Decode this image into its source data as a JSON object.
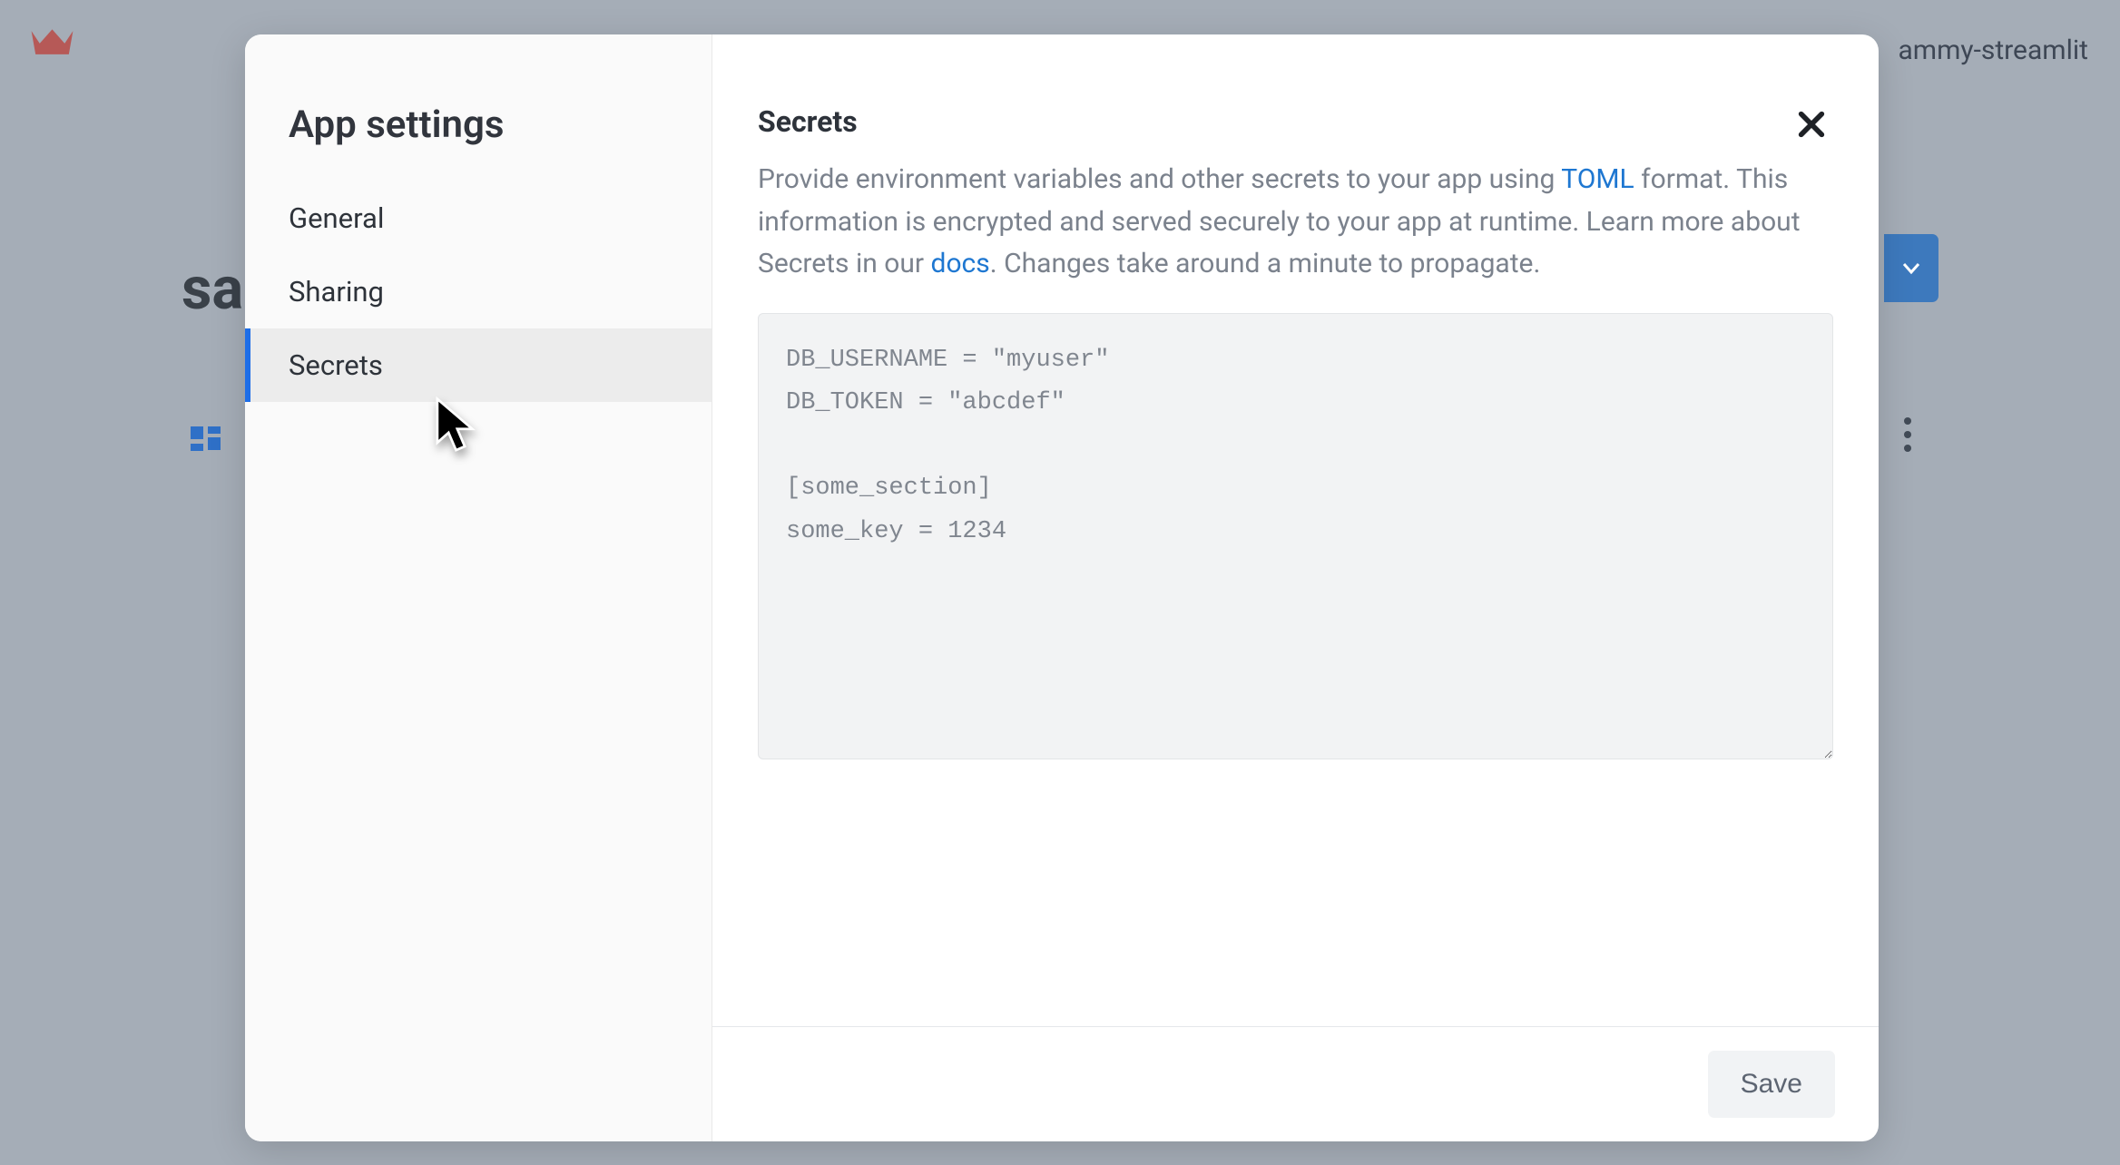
{
  "background": {
    "username": "ammy-streamlit",
    "page_title_fragment": "sa"
  },
  "modal": {
    "title": "App settings",
    "sidebar_items": [
      {
        "label": "General"
      },
      {
        "label": "Sharing"
      },
      {
        "label": "Secrets"
      }
    ],
    "active_index": 2
  },
  "content": {
    "heading": "Secrets",
    "desc_part1": "Provide environment variables and other secrets to your app using ",
    "toml_link_text": "TOML",
    "desc_part2": " format. This information is encrypted and served securely to your app at runtime. Learn more about Secrets in our ",
    "docs_link_text": "docs",
    "desc_part3": ". Changes take around a minute to propagate.",
    "secrets_value": "DB_USERNAME = \"myuser\"\nDB_TOKEN = \"abcdef\"\n\n[some_section]\nsome_key = 1234"
  },
  "footer": {
    "save_label": "Save"
  }
}
